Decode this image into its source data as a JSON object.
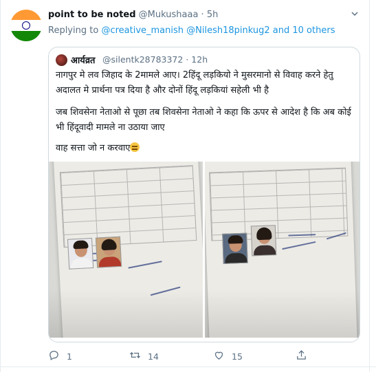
{
  "tweet": {
    "author_name": "point to be noted",
    "author_handle": "@Mukushaaa",
    "separator": "·",
    "time": "5h",
    "replying_prefix": "Replying to",
    "replying_user1": "@creative_manish",
    "replying_user2": "@Nilesh18pinkug2",
    "replying_suffix": "and 10 others"
  },
  "quoted": {
    "author_name": "आर्यव्रत",
    "author_handle": "@silentk28783372",
    "separator": "·",
    "time": "12h",
    "paragraph1": "नागपुर मे लव जिहाद के 2मामले आए। 2हिंदू लड़कियो ने मुसरमानो से विवाह करने हेतु अदालत मे प्रार्थना पत्र दिया है और दोनों हिंदू लड़कियां सहेली भी है",
    "paragraph2": "जब शिवसेना नेताओ से पूछा तब शिवसेना नेताओ ने कहा कि ऊपर से आदेश है कि अब कोई भी हिंदूवादी मामले ना उठाया जाए",
    "paragraph3": "वाह सत्ता जो न करवाए",
    "emoji_name": "unamused-face-emoji",
    "images": [
      "marriage-notice-photo-1",
      "marriage-notice-photo-2"
    ]
  },
  "actions": {
    "reply_count": "1",
    "retweet_count": "14",
    "like_count": "15"
  },
  "colors": {
    "link": "#1b95e0",
    "secondary_text": "#5b7083",
    "border": "#cfd9de"
  },
  "icons": [
    "chevron-down-icon",
    "reply-icon",
    "retweet-icon",
    "like-icon",
    "share-icon"
  ]
}
